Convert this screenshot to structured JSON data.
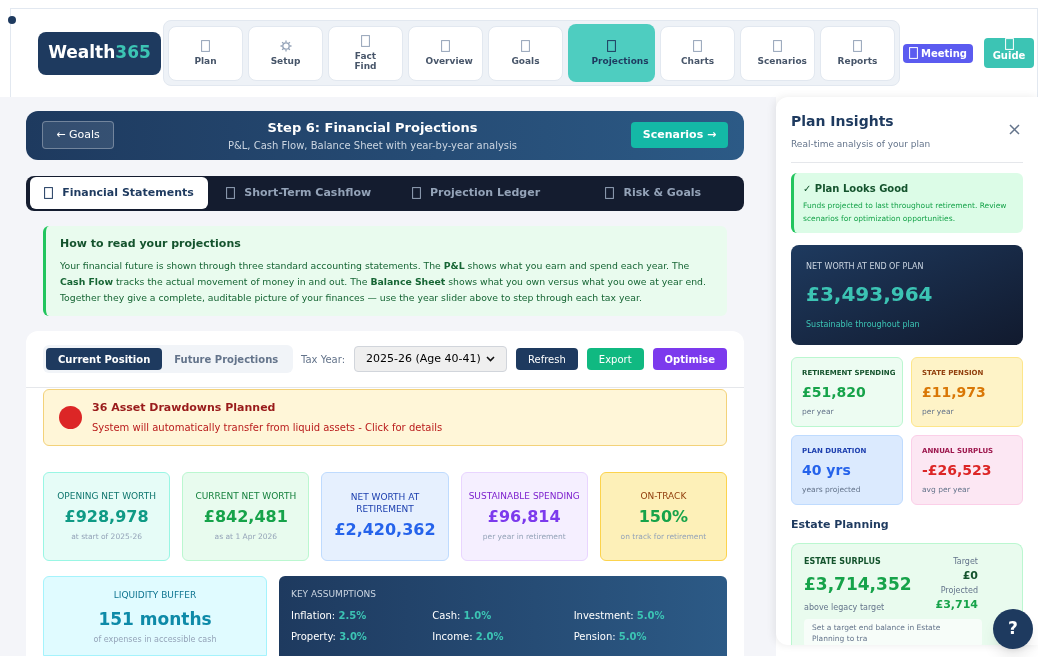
{
  "logo": {
    "text": "Wealth",
    "accent": "365"
  },
  "nav": [
    {
      "label": "Plan",
      "kind": "box",
      "selected": false
    },
    {
      "label": "Setup",
      "kind": "gear",
      "selected": false
    },
    {
      "label": "Fact Find",
      "kind": "box",
      "selected": false
    },
    {
      "label": "Overview",
      "kind": "box",
      "selected": false
    },
    {
      "label": "Goals",
      "kind": "box",
      "selected": false
    },
    {
      "label": "Projections",
      "kind": "box",
      "selected": true
    },
    {
      "label": "Charts",
      "kind": "box",
      "selected": false
    },
    {
      "label": "Scenarios",
      "kind": "box",
      "selected": false
    },
    {
      "label": "Reports",
      "kind": "box",
      "selected": false
    }
  ],
  "meeting_button": "Meeting",
  "guide_button": "Guide",
  "step": {
    "back": "← Goals",
    "title": "Step 6: Financial Projections",
    "subtitle": "P&L, Cash Flow, Balance Sheet with year-by-year analysis",
    "next": "Scenarios →"
  },
  "tabs": [
    {
      "label": "Financial Statements",
      "selected": true
    },
    {
      "label": "Short-Term Cashflow",
      "selected": false
    },
    {
      "label": "Projection Ledger",
      "selected": false
    },
    {
      "label": "Risk & Goals",
      "selected": false
    }
  ],
  "info": {
    "title": "How to read your projections",
    "text": "Your financial future is shown through three standard accounting statements. The **P&L** shows what you earn and spend each year. The **Cash Flow** tracks the actual movement of money in and out. The **Balance Sheet** shows what you own versus what you owe at year end. Together they give a complete, auditable picture of your finances — use the year slider above to step through each tax year."
  },
  "view_toggle": [
    {
      "label": "Current Position",
      "selected": true
    },
    {
      "label": "Future Projections",
      "selected": false
    }
  ],
  "tax_year": {
    "label": "Tax Year:",
    "value": "2025-26 (Age 40-41)"
  },
  "actions": [
    {
      "label": "Refresh",
      "kind": "navy"
    },
    {
      "label": "Export",
      "kind": "green"
    },
    {
      "label": "Optimise",
      "kind": "purple"
    }
  ],
  "alert": {
    "title": "36 Asset Drawdowns Planned",
    "text": "System will automatically transfer from liquid assets - Click for details"
  },
  "metrics": [
    {
      "label": "OPENING NET WORTH",
      "value": "£928,978",
      "note": "at start of 2025-26",
      "kind": "teal"
    },
    {
      "label": "CURRENT NET WORTH",
      "value": "£842,481",
      "note": "as at 1 Apr 2026",
      "kind": "green"
    },
    {
      "label": "NET WORTH AT RETIREMENT",
      "value": "£2,420,362",
      "kind": "blue"
    },
    {
      "label": "SUSTAINABLE SPENDING",
      "value": "£96,814",
      "note": "per year in retirement",
      "kind": "purple"
    },
    {
      "label": "ON-TRACK",
      "value": "150%",
      "note": "on track for retirement",
      "kind": "amber"
    }
  ],
  "liquidity": {
    "label": "LIQUIDITY BUFFER",
    "value": "151 months",
    "note": "of expenses in accessible cash"
  },
  "assumptions": {
    "title": "KEY ASSUMPTIONS",
    "items": [
      {
        "label": "Inflation:",
        "value": "2.5%"
      },
      {
        "label": "Cash:",
        "value": "1.0%"
      },
      {
        "label": "Investment:",
        "value": "5.0%"
      },
      {
        "label": "Property:",
        "value": "3.0%"
      },
      {
        "label": "Income:",
        "value": "2.0%"
      },
      {
        "label": "Pension:",
        "value": "5.0%"
      }
    ]
  },
  "insights": {
    "title": "Plan Insights",
    "subtitle": "Real-time analysis of your plan",
    "status": {
      "title": "✓ Plan Looks Good",
      "text": "Funds projected to last throughout retirement. Review scenarios for optimization opportunities."
    },
    "end_worth": {
      "label": "NET WORTH AT END OF PLAN",
      "value": "£3,493,964",
      "note": "Sustainable throughout plan"
    },
    "stats": [
      {
        "label": "RETIREMENT SPENDING",
        "value": "£51,820",
        "note": "per year",
        "kind": "green"
      },
      {
        "label": "STATE PENSION",
        "value": "£11,973",
        "note": "per year",
        "kind": "amber"
      },
      {
        "label": "PLAN DURATION",
        "value": "40 yrs",
        "note": "years projected",
        "kind": "blue"
      },
      {
        "label": "ANNUAL SURPLUS",
        "value": "-£26,523",
        "note": "avg per year",
        "kind": "pink"
      }
    ],
    "estate_heading": "Estate Planning",
    "estate": {
      "label": "ESTATE SURPLUS",
      "value": "£3,714,352",
      "note": "above legacy target",
      "target_label": "Target",
      "target": "£0",
      "projected_label": "Projected",
      "projected": "£3,714",
      "hint": "Set a target end balance in Estate Planning to tra"
    }
  },
  "help_button": "?"
}
